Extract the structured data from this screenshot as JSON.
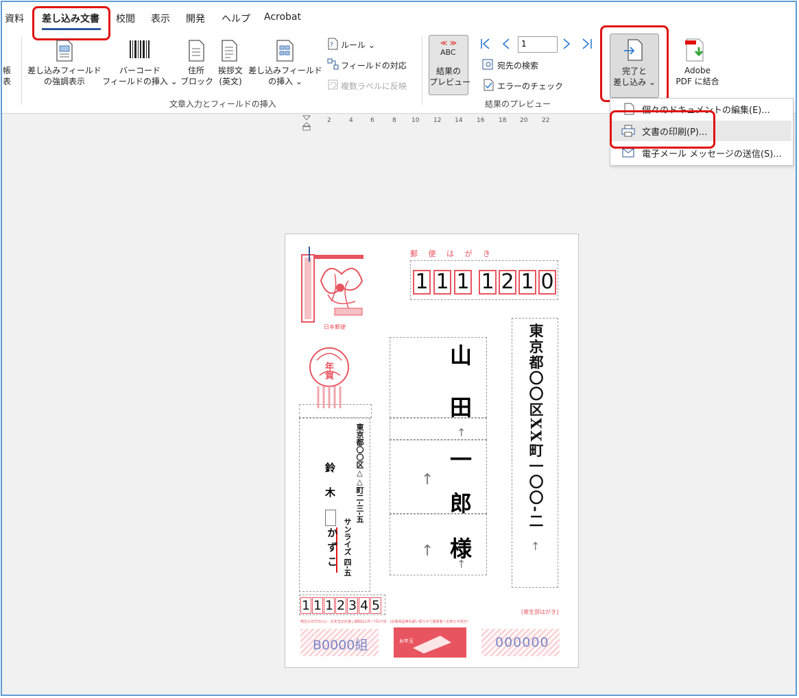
{
  "tabs": [
    "資料",
    "差し込み文書",
    "校閲",
    "表示",
    "開発",
    "ヘルプ",
    "Acrobat"
  ],
  "ribbon": {
    "highlight_fields": "差し込みフィールド\nの強調表示",
    "barcode_field": "バーコード\nフィールドの挿入 ⌄",
    "address_block": "住所\nブロック",
    "greeting": "挨拶文\n(英文)",
    "insert_field": "差し込みフィールド\nの挿入 ⌄",
    "rules": "ルール ⌄",
    "match_fields": "フィールドの対応",
    "update_labels": "複数ラベルに反映",
    "group_write": "文章入力とフィールドの挿入",
    "abc": "ABC",
    "preview_results": "結果の\nプレビュー",
    "record_number": "1",
    "find_recipient": "宛先の検索",
    "check_errors": "エラーのチェック",
    "group_preview": "結果のプレビュー",
    "finish_merge": "完了と\n差し込み ⌄",
    "adobe_merge": "Adobe\nPDF に結合",
    "left_partial": "帳\n表"
  },
  "menu": {
    "edit_docs": "個々のドキュメントの編集(E)...",
    "print_docs": "文書の印刷(P)...",
    "send_email": "電子メール メッセージの送信(S)..."
  },
  "ruler": [
    "2",
    "4",
    "6",
    "8",
    "10",
    "12",
    "14",
    "16",
    "18",
    "20",
    "22"
  ],
  "postcard": {
    "header": "郵 便 は が き",
    "zip_digits": [
      "1",
      "1",
      "1",
      "1",
      "2",
      "1",
      "0"
    ],
    "recipient_address": "東京都〇〇区XX町一〇〇-二",
    "recipient_name": [
      "山",
      "田",
      "一",
      "郎",
      "様"
    ],
    "sender_address": "東京都〇〇区△△町二-三-五",
    "sender_building": "サンライズ 四-五",
    "sender_names": [
      "鈴",
      "木",
      "かずこ"
    ],
    "sender_zip": "1112345",
    "stamp_text": "年賀",
    "japan_post": "日本郵便",
    "lottery_label": "B0000組",
    "lottery_number": "000000",
    "prize_tag": "[寄生部はがき]",
    "fine_print": "発生の日付日(火)　お年玉のお渡し期間は1月~7月17日　(応募商品等を顧い取らせて関係者へお知らせ頂き)"
  },
  "colors": {
    "accent": "#2b579a",
    "highlight": "#e01010",
    "postcard_pink": "#e8545f"
  }
}
